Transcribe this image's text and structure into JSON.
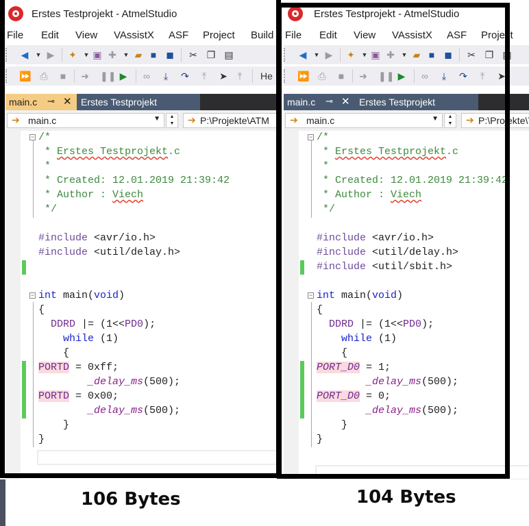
{
  "window": {
    "title": "Erstes Testprojekt - AtmelStudio"
  },
  "menu": [
    "File",
    "Edit",
    "View",
    "VAssistX",
    "ASF",
    "Project",
    "Build"
  ],
  "menu_right": [
    "File",
    "Edit",
    "View",
    "VAssistX",
    "ASF",
    "Project"
  ],
  "toolbar_text": "He",
  "tabs": {
    "active": "main.c",
    "second": "Erstes Testprojekt"
  },
  "navbar": {
    "file_combo": "main.c",
    "path_left": "P:\\Projekte\\ATM",
    "path_right": "P:\\Projekte\\Te"
  },
  "left": {
    "lines": [
      "/*",
      " * Erstes Testprojekt.c",
      " *",
      " * Created: 12.01.2019 21:39:42",
      " * Author : Viech",
      " */",
      "",
      "#include <avr/io.h>",
      "#include <util/delay.h>",
      "",
      "",
      "int main(void)",
      "{",
      "  DDRD |= (1<<PD0);",
      "    while (1)",
      "    {",
      "PORTD = 0xff;",
      "        _delay_ms(500);",
      "PORTD = 0x00;",
      "        _delay_ms(500);",
      "    }",
      "}"
    ],
    "caption": "106 Bytes"
  },
  "right": {
    "lines": [
      "/*",
      " * Erstes Testprojekt.c",
      " *",
      " * Created: 12.01.2019 21:39:42",
      " * Author : Viech",
      " */",
      "",
      "#include <avr/io.h>",
      "#include <util/delay.h>",
      "#include <util/sbit.h>",
      "",
      "int main(void)",
      "{",
      "  DDRD |= (1<<PD0);",
      "    while (1)",
      "    {",
      "PORT_D0 = 1;",
      "        _delay_ms(500);",
      "PORT_D0 = 0;",
      "        _delay_ms(500);",
      "    }",
      "}"
    ],
    "caption": "104 Bytes"
  },
  "colors": {
    "comment": "#3c8a3c",
    "keyword": "#1a22c8",
    "preprocessor": "#6f4c9a",
    "change_marker": "#5cc95c",
    "active_tab": "#f5cc84",
    "tab_strip": "#2d2d30"
  }
}
